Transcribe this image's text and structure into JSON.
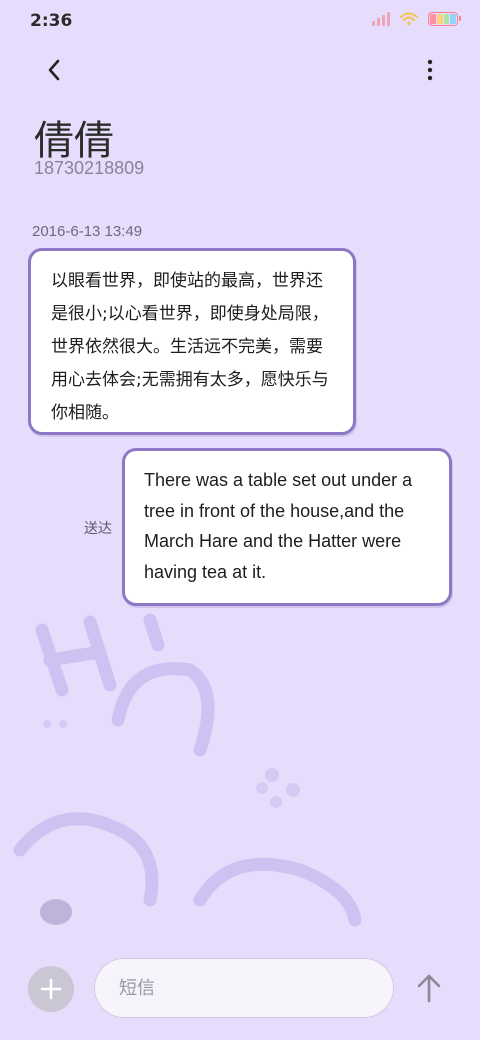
{
  "status_bar": {
    "time": "2:36",
    "signal_color": "#f0a2b8",
    "wifi_color": "#f3c34a",
    "battery_colors": [
      "#ff8fa3",
      "#ffd27a",
      "#a8e6a1",
      "#8fd3ff"
    ]
  },
  "header": {
    "back_icon": "chevron-left-icon",
    "more_icon": "more-vertical-icon",
    "contact_name": "倩倩",
    "contact_number": "18730218809"
  },
  "conversation": {
    "timestamp": "2016-6-13 13:49",
    "messages": [
      {
        "direction": "incoming",
        "text": "以眼看世界，即使站的最高，世界还是很小;以心看世界，即使身处局限，世界依然很大。生活远不完美，需要用心去体会;无需拥有太多，愿快乐与你相随。"
      },
      {
        "direction": "outgoing",
        "text": "There was a table set out under a tree in front of the house,and the March Hare and the Hatter were having tea at it.",
        "status": "送达"
      }
    ]
  },
  "composer": {
    "add_icon": "plus-icon",
    "placeholder": "短信",
    "send_icon": "arrow-up-icon"
  },
  "colors": {
    "background": "#e6dcfb",
    "bubble_border": "#8e78c6",
    "bubble_fill": "#ffffff"
  }
}
